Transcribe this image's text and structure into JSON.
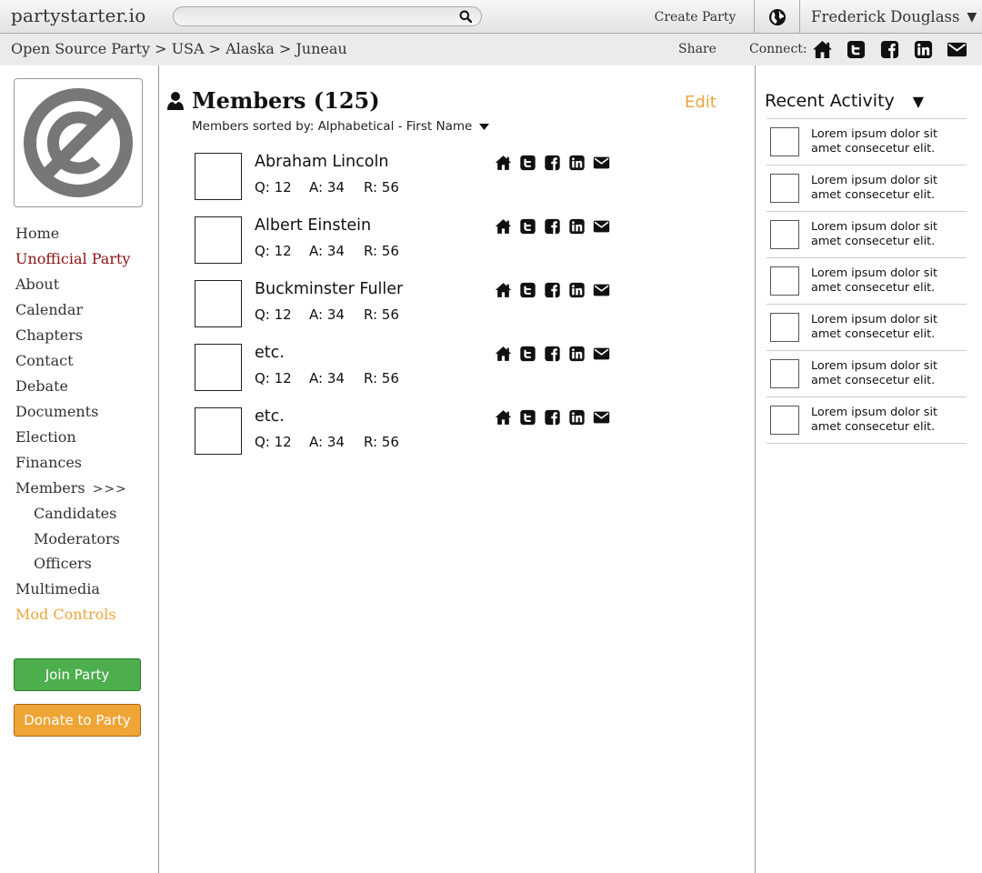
{
  "header": {
    "logo": "partystarter.io",
    "search_placeholder": "",
    "create_party": "Create Party",
    "user_name": "Frederick Douglass",
    "user_caret": "▼"
  },
  "breadcrumb": {
    "path": "Open Source Party > USA > Alaska > Juneau",
    "share": "Share",
    "connect_label": "Connect:",
    "connect_icons": [
      "home-icon",
      "twitter-icon",
      "facebook-icon",
      "linkedin-icon",
      "email-icon"
    ]
  },
  "sidebar": {
    "items": [
      {
        "label": "Home"
      },
      {
        "label": "Unofficial Party"
      },
      {
        "label": "About"
      },
      {
        "label": "Calendar"
      },
      {
        "label": "Chapters"
      },
      {
        "label": "Contact"
      },
      {
        "label": "Debate"
      },
      {
        "label": "Documents"
      },
      {
        "label": "Election"
      },
      {
        "label": "Finances"
      },
      {
        "label": "Members",
        "suffix": ">>>"
      },
      {
        "label": "Candidates"
      },
      {
        "label": "Moderators"
      },
      {
        "label": "Officers"
      },
      {
        "label": "Multimedia"
      },
      {
        "label": "Mod Controls"
      }
    ],
    "join_button": "Join Party",
    "donate_button": "Donate to Party"
  },
  "main": {
    "title": "Members (125)",
    "edit": "Edit",
    "sorted_by": "Members sorted by: Alphabetical - First Name",
    "members": [
      {
        "name": "Abraham Lincoln",
        "q": "Q: 12",
        "a": "A: 34",
        "r": "R: 56"
      },
      {
        "name": "Albert Einstein",
        "q": "Q: 12",
        "a": "A: 34",
        "r": "R: 56"
      },
      {
        "name": "Buckminster Fuller",
        "q": "Q: 12",
        "a": "A: 34",
        "r": "R: 56"
      },
      {
        "name": "etc.",
        "q": "Q: 12",
        "a": "A: 34",
        "r": "R: 56"
      },
      {
        "name": "etc.",
        "q": "Q: 12",
        "a": "A: 34",
        "r": "R: 56"
      }
    ]
  },
  "recent_activity": {
    "title": "Recent Activity",
    "caret": "▼",
    "items": [
      {
        "text": "Lorem ipsum dolor sit amet consecetur elit."
      },
      {
        "text": "Lorem ipsum dolor sit amet consecetur elit."
      },
      {
        "text": "Lorem ipsum dolor sit amet consecetur elit."
      },
      {
        "text": "Lorem ipsum dolor sit amet consecetur elit."
      },
      {
        "text": "Lorem ipsum dolor sit amet consecetur elit."
      },
      {
        "text": "Lorem ipsum dolor sit amet consecetur elit."
      },
      {
        "text": "Lorem ipsum dolor sit amet consecetur elit."
      }
    ]
  },
  "colors": {
    "active_nav": "#8b1010",
    "mod_controls": "#eda43c",
    "edit": "#eda43c",
    "join_button": "#4cae4c",
    "donate_button": "#eea536"
  }
}
